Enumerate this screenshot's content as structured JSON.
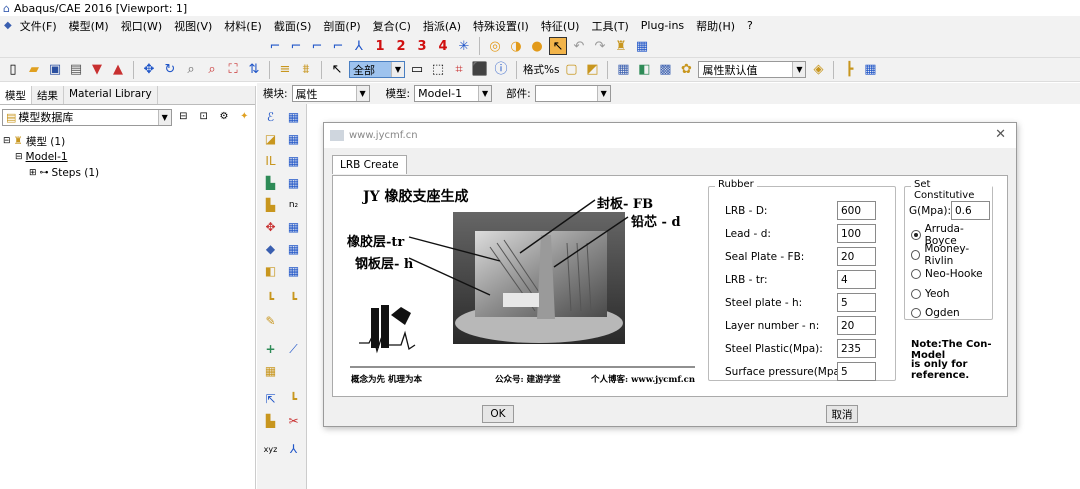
{
  "window": {
    "title": "Abaqus/CAE 2016 [Viewport: 1]"
  },
  "menu": [
    "文件(F)",
    "模型(M)",
    "视口(W)",
    "视图(V)",
    "材料(E)",
    "截面(S)",
    "剖面(P)",
    "复合(C)",
    "指派(A)",
    "特殊设置(I)",
    "特征(U)",
    "工具(T)",
    "Plug-ins",
    "帮助(H)",
    "?"
  ],
  "toolbar1": {
    "nums": [
      "1",
      "2",
      "3",
      "4"
    ]
  },
  "toolbar2": {
    "select_value": "全部",
    "format_label": "格式%s",
    "attr_select": "属性默认值"
  },
  "context": {
    "module_label": "模块:",
    "module_value": "属性",
    "model_label": "模型:",
    "model_value": "Model-1",
    "part_label": "部件:",
    "part_value": ""
  },
  "left_panel": {
    "tabs": [
      "模型",
      "结果",
      "Material Library"
    ],
    "db_select": "模型数据库",
    "tree": {
      "root": "模型 (1)",
      "model": "Model-1",
      "steps": "Steps (1)"
    }
  },
  "dialog": {
    "site": "www.jycmf.cn",
    "tab": "LRB Create",
    "figure": {
      "title": "JY 橡胶支座生成",
      "label_fb": "封板- FB",
      "label_d": "铅芯 - d",
      "label_tr": "橡胶层-tr",
      "label_h": "钢板层- h",
      "footer_left": "概念为先 机理为本",
      "footer_mid": "公众号: 建游学堂",
      "footer_right": "个人博客: www.jycmf.cn"
    },
    "rubber": {
      "legend": "Rubber",
      "fields": [
        {
          "label": "LRB - D:",
          "value": "600"
        },
        {
          "label": "Lead - d:",
          "value": "100"
        },
        {
          "label": "Seal Plate - FB:",
          "value": "20"
        },
        {
          "label": "LRB - tr:",
          "value": "4"
        },
        {
          "label": "Steel plate - h:",
          "value": "5"
        },
        {
          "label": "Layer number - n:",
          "value": "20"
        },
        {
          "label": "Steel Plastic(Mpa):",
          "value": "235"
        },
        {
          "label": "Surface pressure(Mpa):",
          "value": "5"
        }
      ]
    },
    "constitutive": {
      "legend": "Set Constitutive",
      "g_label": "G(Mpa):",
      "g_value": "0.6",
      "options": [
        "Arruda-Boyce",
        "Mooney-Rivlin",
        "Neo-Hooke",
        "Yeoh",
        "Ogden"
      ],
      "selected": "Arruda-Boyce"
    },
    "note1": "Note:The Con-Model",
    "note2": "is only for reference.",
    "ok": "OK",
    "cancel": "取消"
  },
  "colors": {
    "accent_blue": "#1f55c8",
    "num_red": "#d01010"
  }
}
